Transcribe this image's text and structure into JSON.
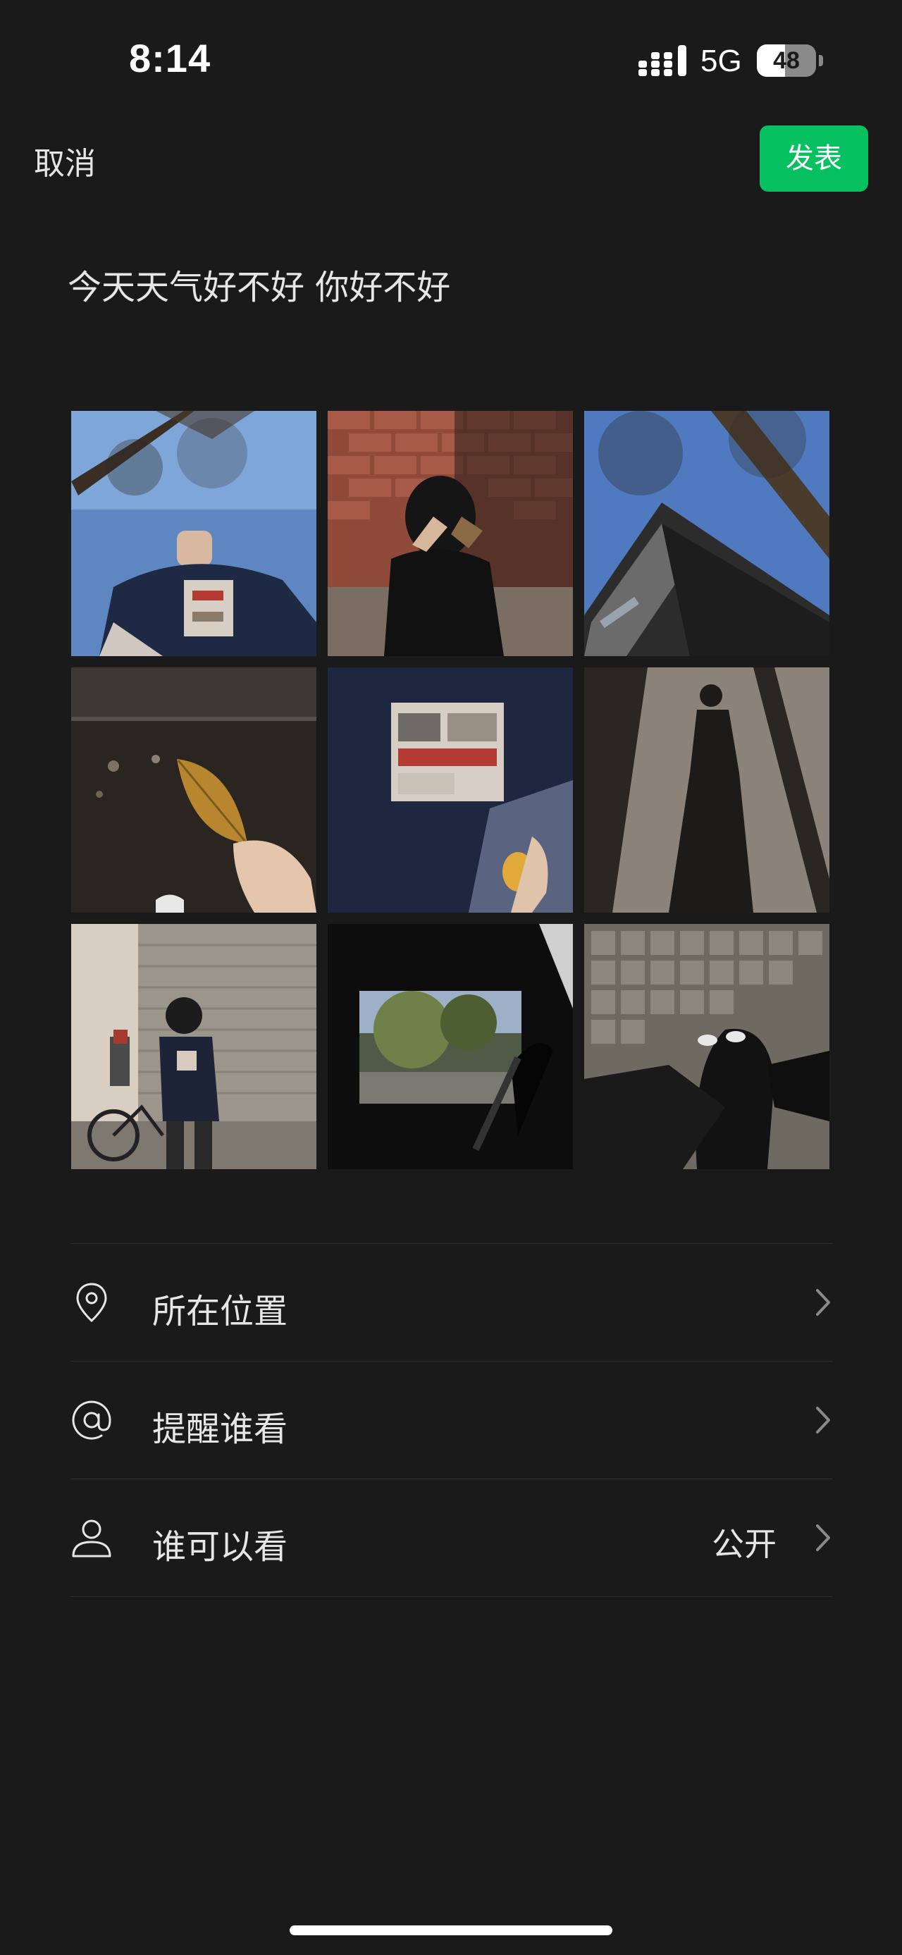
{
  "status_bar": {
    "time": "8:14",
    "network": "5G",
    "battery_level": "48",
    "battery_fraction": 0.48
  },
  "nav": {
    "cancel_label": "取消",
    "publish_label": "发表",
    "publish_color": "#07c160"
  },
  "post": {
    "text": "今天天气好不好 你好不好"
  },
  "photos": [
    {
      "icon": "photo-low-angle-tree-icon"
    },
    {
      "icon": "photo-brick-wall-leaf-icon"
    },
    {
      "icon": "photo-roof-sky-icon"
    },
    {
      "icon": "photo-leaf-hand-icon"
    },
    {
      "icon": "photo-tshirt-closeup-icon"
    },
    {
      "icon": "photo-shadow-icon"
    },
    {
      "icon": "photo-street-bicycle-icon"
    },
    {
      "icon": "photo-car-window-icon"
    },
    {
      "icon": "photo-tiled-floor-feet-icon"
    }
  ],
  "options": {
    "location": {
      "label": "所在位置",
      "icon": "location-pin-icon"
    },
    "mention": {
      "label": "提醒谁看",
      "icon": "at-sign-icon"
    },
    "visibility": {
      "label": "谁可以看",
      "value": "公开",
      "icon": "person-icon"
    }
  }
}
